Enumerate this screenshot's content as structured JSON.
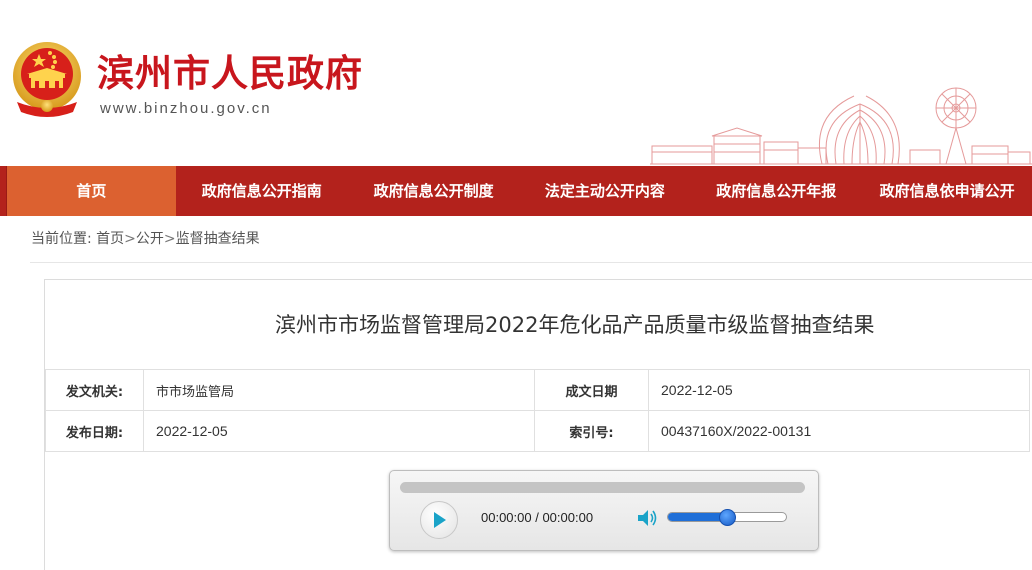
{
  "header": {
    "site_title": "滨州市人民政府",
    "site_domain": "www.binzhou.gov.cn",
    "brand_color": "#c8161d"
  },
  "nav": {
    "items": [
      {
        "label": "首页",
        "active": true
      },
      {
        "label": "政府信息公开指南",
        "active": false
      },
      {
        "label": "政府信息公开制度",
        "active": false
      },
      {
        "label": "法定主动公开内容",
        "active": false
      },
      {
        "label": "政府信息公开年报",
        "active": false
      },
      {
        "label": "政府信息依申请公开",
        "active": false
      }
    ],
    "bg_color": "#b3221c",
    "active_color": "#dc6130"
  },
  "breadcrumb": {
    "prefix": "当前位置:",
    "items": [
      "首页",
      "公开",
      "监督抽查结果"
    ],
    "separator": ">"
  },
  "article": {
    "title": "滨州市市场监督管理局2022年危化品产品质量市级监督抽查结果",
    "meta": {
      "issuer_label": "发文机关:",
      "issuer_value": "市市场监管局",
      "created_label": "成文日期",
      "created_value": "2022-12-05",
      "published_label": "发布日期:",
      "published_value": "2022-12-05",
      "index_label": "索引号:",
      "index_value": "00437160X/2022-00131"
    }
  },
  "player": {
    "time": "00:00:00 / 00:00:00",
    "volume": 0.5,
    "play_icon": "play-icon",
    "volume_icon": "speaker-icon"
  }
}
